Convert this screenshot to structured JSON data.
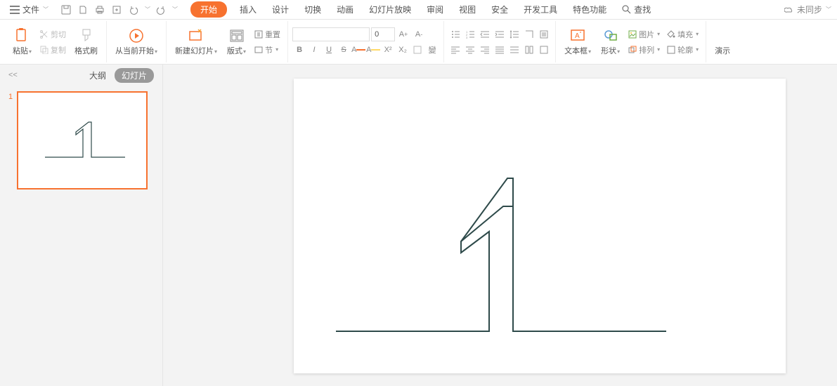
{
  "menubar": {
    "file": "文件",
    "tabs": [
      "开始",
      "插入",
      "设计",
      "切换",
      "动画",
      "幻灯片放映",
      "审阅",
      "视图",
      "安全",
      "开发工具",
      "特色功能"
    ],
    "activeTab": 0,
    "search": "查找",
    "sync": "未同步"
  },
  "ribbon": {
    "paste": "粘贴",
    "cut": "剪切",
    "copy": "复制",
    "formatPainter": "格式刷",
    "fromBeginning": "从当前开始",
    "newSlide": "新建幻灯片",
    "layout": "版式",
    "reset": "重置",
    "section": "节",
    "fontSize": "0",
    "textbox": "文本框",
    "shape": "形状",
    "picture": "图片",
    "fill": "填充",
    "arrange": "排列",
    "outline": "轮廓",
    "presentLast": "演示"
  },
  "sidepanel": {
    "outline": "大纲",
    "slides": "幻灯片",
    "slideNumber": "1"
  }
}
